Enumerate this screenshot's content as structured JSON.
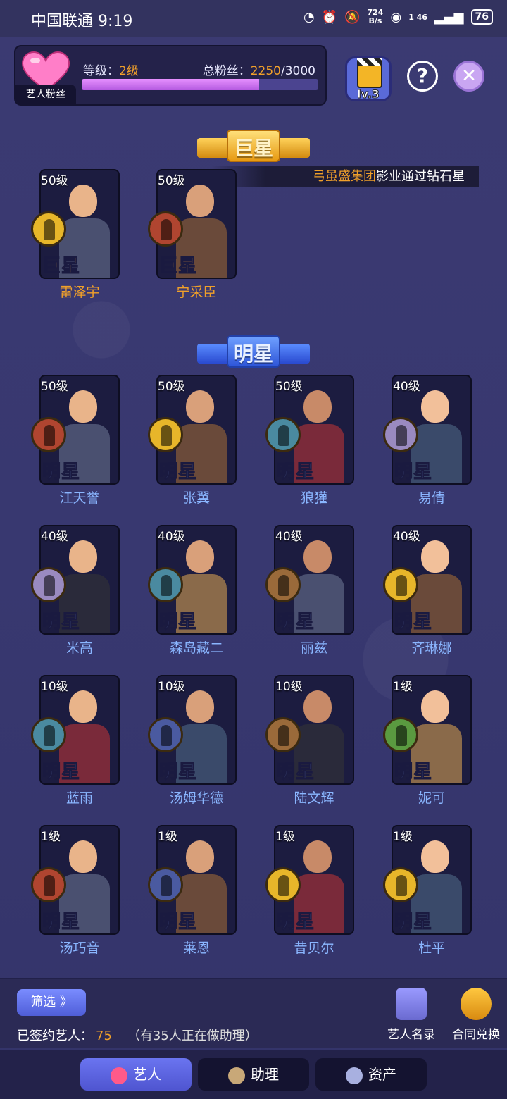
{
  "status_bar": {
    "carrier_time": "中国联通 9:19",
    "net_speed_top": "724",
    "net_speed_bottom": "B/s",
    "signal": "1 46",
    "battery": "76"
  },
  "header": {
    "fan_tag": "艺人粉丝",
    "level_label": "等级：",
    "level_value": "2级",
    "fans_label": "总粉丝：",
    "fans_current": "2250",
    "fans_total": "/3000",
    "fans_progress": 0.75,
    "studio_level": "lv.3",
    "help_symbol": "?",
    "close_symbol": "✕"
  },
  "superstar_section": {
    "title": "巨星",
    "announcement_highlight": "弓虽盛集团",
    "announcement_text": "影业通过钻石星"
  },
  "star_section": {
    "title": "明星"
  },
  "superstars": [
    {
      "level": "50级",
      "rank": "巨星",
      "name": "雷泽宇",
      "badge": "gold"
    },
    {
      "level": "50级",
      "rank": "巨星",
      "name": "宁采臣",
      "badge": "red"
    }
  ],
  "stars": [
    {
      "level": "50级",
      "rank": "明星",
      "name": "江天誉",
      "badge": "red"
    },
    {
      "level": "50级",
      "rank": "明星",
      "name": "张翼",
      "badge": "gold"
    },
    {
      "level": "50级",
      "rank": "明星",
      "name": "狼獾",
      "badge": "teal"
    },
    {
      "level": "40级",
      "rank": "明星",
      "name": "易倩",
      "badge": "lilac"
    },
    {
      "level": "40级",
      "rank": "明星",
      "name": "米高",
      "badge": "lilac"
    },
    {
      "level": "40级",
      "rank": "明星",
      "name": "森岛藏二",
      "badge": "teal"
    },
    {
      "level": "40级",
      "rank": "明星",
      "name": "丽兹",
      "badge": "brown"
    },
    {
      "level": "40级",
      "rank": "明星",
      "name": "齐琳娜",
      "badge": "gold"
    },
    {
      "level": "10级",
      "rank": "明星",
      "name": "蓝雨",
      "badge": "teal"
    },
    {
      "level": "10级",
      "rank": "明星",
      "name": "汤姆华德",
      "badge": "navy"
    },
    {
      "level": "10级",
      "rank": "明星",
      "name": "陆文辉",
      "badge": "brown"
    },
    {
      "level": "1级",
      "rank": "明星",
      "name": "妮可",
      "badge": "green"
    },
    {
      "level": "1级",
      "rank": "明星",
      "name": "汤巧音",
      "badge": "red"
    },
    {
      "level": "1级",
      "rank": "明星",
      "name": "莱恩",
      "badge": "navy"
    },
    {
      "level": "1级",
      "rank": "明星",
      "name": "昔贝尔",
      "badge": "gold"
    },
    {
      "level": "1级",
      "rank": "明星",
      "name": "杜平",
      "badge": "gold"
    }
  ],
  "bottom": {
    "filter_label": "筛选 》",
    "signed_label": "已签约艺人：",
    "signed_count": "75",
    "assistant_note": "（有35人正在做助理）",
    "roster_label": "艺人名录",
    "contract_label": "合同兑换"
  },
  "tabs": [
    {
      "label": "艺人",
      "active": true
    },
    {
      "label": "助理",
      "active": false
    },
    {
      "label": "资产",
      "active": false
    }
  ],
  "colors": {
    "accent_orange": "#f0a02a",
    "name_blue": "#8ab6ff",
    "tab_active": "#5a63e0"
  }
}
